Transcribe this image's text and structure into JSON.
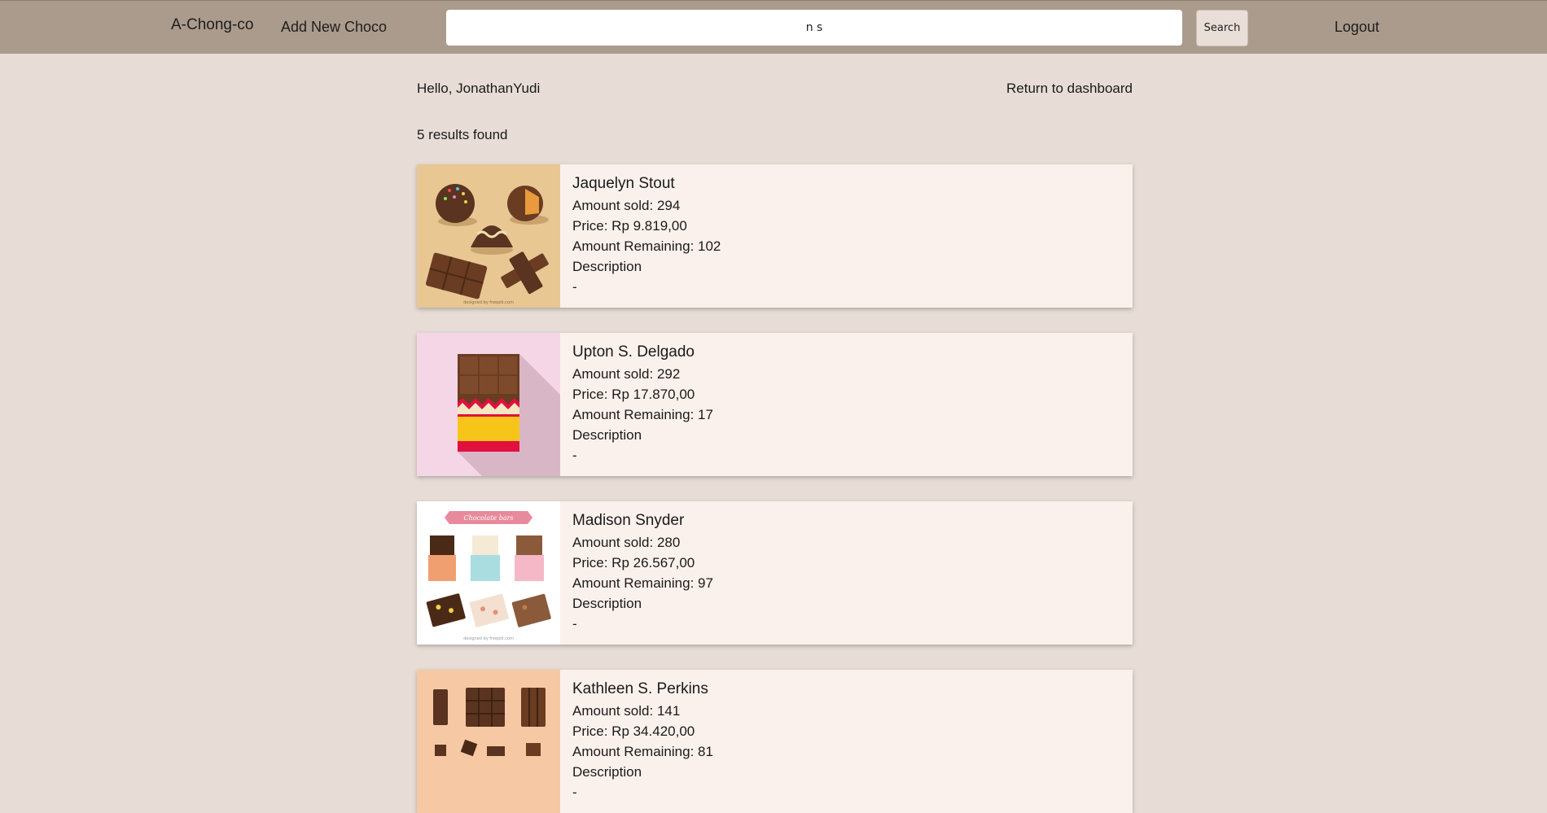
{
  "navbar": {
    "brand": "A-Chong-co",
    "add_new": "Add New Choco",
    "search_value": "n s",
    "search_button": "Search",
    "logout": "Logout"
  },
  "greeting": "Hello, JonathanYudi",
  "return_dashboard": "Return to dashboard",
  "results_text": "5 results found",
  "products": [
    {
      "name": "Jaquelyn Stout",
      "amount_sold": "Amount sold: 294",
      "price": "Price: Rp 9.819,00",
      "remaining": "Amount Remaining: 102",
      "description_label": "Description",
      "description": "-",
      "image": "chocolate-assortment-image"
    },
    {
      "name": "Upton S. Delgado",
      "amount_sold": "Amount sold: 292",
      "price": "Price: Rp 17.870,00",
      "remaining": "Amount Remaining: 17",
      "description_label": "Description",
      "description": "-",
      "image": "chocolate-bar-wrapper-image"
    },
    {
      "name": "Madison Snyder",
      "amount_sold": "Amount sold: 280",
      "price": "Price: Rp 26.567,00",
      "remaining": "Amount Remaining: 97",
      "description_label": "Description",
      "description": "-",
      "image": "chocolate-bars-set-image"
    },
    {
      "name": "Kathleen S. Perkins",
      "amount_sold": "Amount sold: 141",
      "price": "Price: Rp 34.420,00",
      "remaining": "Amount Remaining: 81",
      "description_label": "Description",
      "description": "-",
      "image": "chocolate-pieces-image"
    }
  ],
  "colors": {
    "navbar": "#ab9b8c",
    "background": "#e7ddd6",
    "card": "#fbf1ec"
  }
}
